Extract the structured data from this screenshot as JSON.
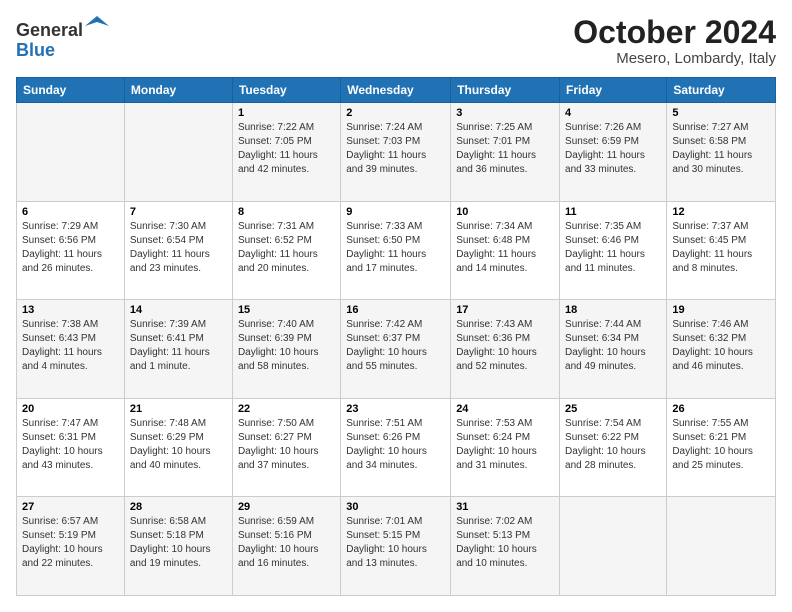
{
  "header": {
    "logo": {
      "line1": "General",
      "line2": "Blue"
    },
    "month": "October 2024",
    "location": "Mesero, Lombardy, Italy"
  },
  "weekdays": [
    "Sunday",
    "Monday",
    "Tuesday",
    "Wednesday",
    "Thursday",
    "Friday",
    "Saturday"
  ],
  "weeks": [
    [
      null,
      null,
      {
        "day": 1,
        "sunrise": "7:22 AM",
        "sunset": "7:05 PM",
        "daylight": "11 hours and 42 minutes."
      },
      {
        "day": 2,
        "sunrise": "7:24 AM",
        "sunset": "7:03 PM",
        "daylight": "11 hours and 39 minutes."
      },
      {
        "day": 3,
        "sunrise": "7:25 AM",
        "sunset": "7:01 PM",
        "daylight": "11 hours and 36 minutes."
      },
      {
        "day": 4,
        "sunrise": "7:26 AM",
        "sunset": "6:59 PM",
        "daylight": "11 hours and 33 minutes."
      },
      {
        "day": 5,
        "sunrise": "7:27 AM",
        "sunset": "6:58 PM",
        "daylight": "11 hours and 30 minutes."
      }
    ],
    [
      {
        "day": 6,
        "sunrise": "7:29 AM",
        "sunset": "6:56 PM",
        "daylight": "11 hours and 26 minutes."
      },
      {
        "day": 7,
        "sunrise": "7:30 AM",
        "sunset": "6:54 PM",
        "daylight": "11 hours and 23 minutes."
      },
      {
        "day": 8,
        "sunrise": "7:31 AM",
        "sunset": "6:52 PM",
        "daylight": "11 hours and 20 minutes."
      },
      {
        "day": 9,
        "sunrise": "7:33 AM",
        "sunset": "6:50 PM",
        "daylight": "11 hours and 17 minutes."
      },
      {
        "day": 10,
        "sunrise": "7:34 AM",
        "sunset": "6:48 PM",
        "daylight": "11 hours and 14 minutes."
      },
      {
        "day": 11,
        "sunrise": "7:35 AM",
        "sunset": "6:46 PM",
        "daylight": "11 hours and 11 minutes."
      },
      {
        "day": 12,
        "sunrise": "7:37 AM",
        "sunset": "6:45 PM",
        "daylight": "11 hours and 8 minutes."
      }
    ],
    [
      {
        "day": 13,
        "sunrise": "7:38 AM",
        "sunset": "6:43 PM",
        "daylight": "11 hours and 4 minutes."
      },
      {
        "day": 14,
        "sunrise": "7:39 AM",
        "sunset": "6:41 PM",
        "daylight": "11 hours and 1 minute."
      },
      {
        "day": 15,
        "sunrise": "7:40 AM",
        "sunset": "6:39 PM",
        "daylight": "10 hours and 58 minutes."
      },
      {
        "day": 16,
        "sunrise": "7:42 AM",
        "sunset": "6:37 PM",
        "daylight": "10 hours and 55 minutes."
      },
      {
        "day": 17,
        "sunrise": "7:43 AM",
        "sunset": "6:36 PM",
        "daylight": "10 hours and 52 minutes."
      },
      {
        "day": 18,
        "sunrise": "7:44 AM",
        "sunset": "6:34 PM",
        "daylight": "10 hours and 49 minutes."
      },
      {
        "day": 19,
        "sunrise": "7:46 AM",
        "sunset": "6:32 PM",
        "daylight": "10 hours and 46 minutes."
      }
    ],
    [
      {
        "day": 20,
        "sunrise": "7:47 AM",
        "sunset": "6:31 PM",
        "daylight": "10 hours and 43 minutes."
      },
      {
        "day": 21,
        "sunrise": "7:48 AM",
        "sunset": "6:29 PM",
        "daylight": "10 hours and 40 minutes."
      },
      {
        "day": 22,
        "sunrise": "7:50 AM",
        "sunset": "6:27 PM",
        "daylight": "10 hours and 37 minutes."
      },
      {
        "day": 23,
        "sunrise": "7:51 AM",
        "sunset": "6:26 PM",
        "daylight": "10 hours and 34 minutes."
      },
      {
        "day": 24,
        "sunrise": "7:53 AM",
        "sunset": "6:24 PM",
        "daylight": "10 hours and 31 minutes."
      },
      {
        "day": 25,
        "sunrise": "7:54 AM",
        "sunset": "6:22 PM",
        "daylight": "10 hours and 28 minutes."
      },
      {
        "day": 26,
        "sunrise": "7:55 AM",
        "sunset": "6:21 PM",
        "daylight": "10 hours and 25 minutes."
      }
    ],
    [
      {
        "day": 27,
        "sunrise": "6:57 AM",
        "sunset": "5:19 PM",
        "daylight": "10 hours and 22 minutes."
      },
      {
        "day": 28,
        "sunrise": "6:58 AM",
        "sunset": "5:18 PM",
        "daylight": "10 hours and 19 minutes."
      },
      {
        "day": 29,
        "sunrise": "6:59 AM",
        "sunset": "5:16 PM",
        "daylight": "10 hours and 16 minutes."
      },
      {
        "day": 30,
        "sunrise": "7:01 AM",
        "sunset": "5:15 PM",
        "daylight": "10 hours and 13 minutes."
      },
      {
        "day": 31,
        "sunrise": "7:02 AM",
        "sunset": "5:13 PM",
        "daylight": "10 hours and 10 minutes."
      },
      null,
      null
    ]
  ],
  "labels": {
    "sunrise": "Sunrise:",
    "sunset": "Sunset:",
    "daylight": "Daylight:"
  }
}
